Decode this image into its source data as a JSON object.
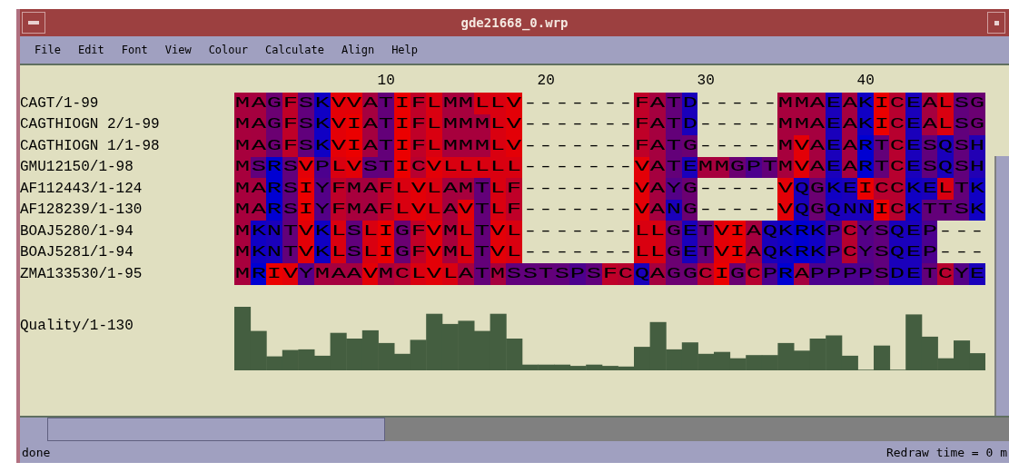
{
  "window": {
    "title": "gde21668_0.wrp"
  },
  "menu": [
    "File",
    "Edit",
    "Font",
    "View",
    "Colour",
    "Calculate",
    "Align",
    "Help"
  ],
  "ruler": [
    "10",
    "20",
    "30",
    "40"
  ],
  "sequences": [
    {
      "name": "CAGT/1-99",
      "residues": "MAGFSKVVATIFLMMLLV-------FATD-----MMAEAKICEALSG"
    },
    {
      "name": "CAGTHIOGN 2/1-99",
      "residues": "MAGFSKVIATIFLMMMLV-------FATD-----MMAEAKICEALSG"
    },
    {
      "name": "CAGTHIOGN 1/1-98",
      "residues": "MAGFSKVIATIFLMMMLV-------FATG-----MVAEARTCESQSH"
    },
    {
      "name": "GMU12150/1-98",
      "residues": "MSRSVPLVSTICVLLLLL-------VATEMMGPTMVAEARTCESQSH"
    },
    {
      "name": "AF112443/1-124",
      "residues": "MARSIYFMAFLVLAMTLF-------VAYG-----VQGKEICCKELTK"
    },
    {
      "name": "AF128239/1-130",
      "residues": "MARSIYFMAFLVLAVTLF-------VANG-----VQGQNNICKTTSK"
    },
    {
      "name": "BOAJ5280/1-94",
      "residues": "MKNTVKLSLIGFVMLTVL-------LLGETVIAQKRKPCYSQEP---"
    },
    {
      "name": "BOAJ5281/1-94",
      "residues": "MKNTVKLSLIGFVMLTVL-------LLGETVIAQKRKPCYSQEP---"
    },
    {
      "name": "ZMA133530/1-95",
      "residues": "MRIVYMAAVMCLVLATMSSTSPSFCQAGGCIGCPRAPPPPSDETCYE"
    }
  ],
  "annotation": {
    "name": "Quality/1-130"
  },
  "status_bar": {
    "message": "done",
    "redraw": "Redraw time = 0 m"
  }
}
